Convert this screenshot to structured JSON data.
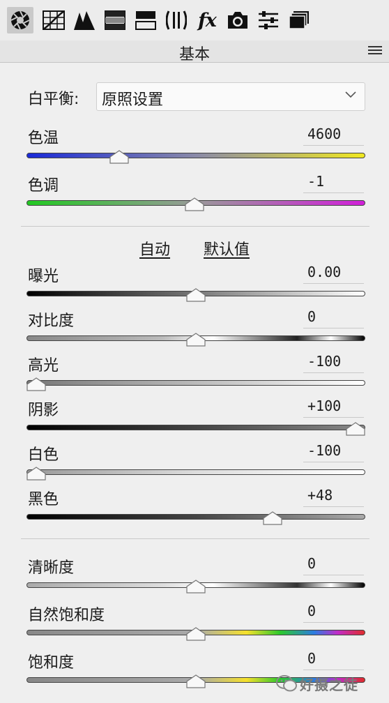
{
  "toolbar": {
    "tools": [
      {
        "icon": "aperture-icon",
        "active": true
      },
      {
        "icon": "tone-curve-icon"
      },
      {
        "icon": "detail-icon"
      },
      {
        "icon": "hsl-icon"
      },
      {
        "icon": "split-toning-icon"
      },
      {
        "icon": "lens-correction-icon"
      },
      {
        "icon": "effects-icon",
        "glyph": "fx"
      },
      {
        "icon": "camera-calibration-icon"
      },
      {
        "icon": "presets-icon"
      },
      {
        "icon": "snapshots-icon"
      }
    ]
  },
  "panel": {
    "title": "基本"
  },
  "white_balance": {
    "label": "白平衡:",
    "value": "原照设置"
  },
  "sliders": [
    {
      "key": "temp",
      "label": "色温",
      "value": "4600",
      "position": 0.26
    },
    {
      "key": "tint",
      "label": "色调",
      "value": "-1",
      "position": 0.495
    },
    {
      "key": "exposure",
      "label": "曝光",
      "value": "0.00",
      "position": 0.5
    },
    {
      "key": "contrast",
      "label": "对比度",
      "value": "0",
      "position": 0.5
    },
    {
      "key": "highlights",
      "label": "高光",
      "value": "-100",
      "position": 0.0
    },
    {
      "key": "shadows",
      "label": "阴影",
      "value": "+100",
      "position": 1.0
    },
    {
      "key": "whites",
      "label": "白色",
      "value": "-100",
      "position": 0.0
    },
    {
      "key": "blacks",
      "label": "黑色",
      "value": "+48",
      "position": 0.74
    },
    {
      "key": "clarity",
      "label": "清晰度",
      "value": "0",
      "position": 0.5
    },
    {
      "key": "vibrance",
      "label": "自然饱和度",
      "value": "0",
      "position": 0.5
    },
    {
      "key": "saturation",
      "label": "饱和度",
      "value": "0",
      "position": 0.5
    }
  ],
  "actions": {
    "auto": "自动",
    "default": "默认值"
  },
  "watermark": {
    "text": "好摄之徒"
  },
  "colors": {
    "temp_start": "#1a2ad8",
    "temp_end": "#f0e820",
    "tint_start": "#22c822",
    "tint_end": "#d020d8"
  }
}
